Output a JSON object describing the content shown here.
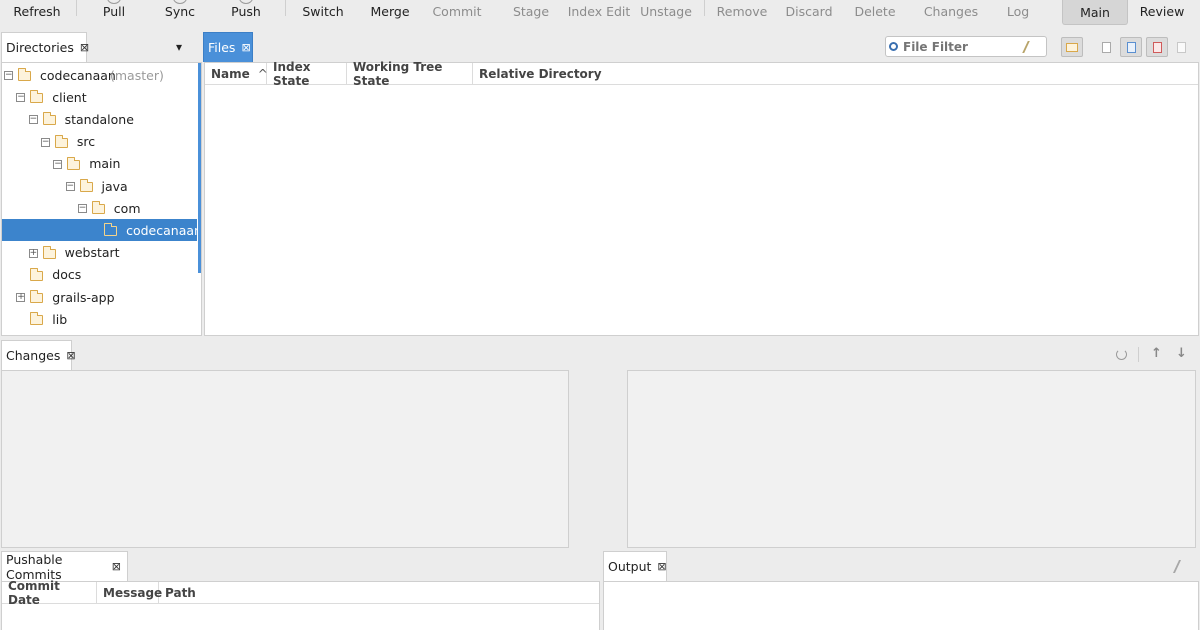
{
  "toolbar": {
    "refresh": "Refresh",
    "pull": "Pull",
    "sync": "Sync",
    "push": "Push",
    "switch": "Switch",
    "merge": "Merge",
    "commit": "Commit",
    "stage": "Stage",
    "index_edit": "Index Edit",
    "unstage": "Unstage",
    "remove": "Remove",
    "discard": "Discard",
    "delete": "Delete",
    "changes": "Changes",
    "log": "Log",
    "main": "Main",
    "review": "Review"
  },
  "directories": {
    "tab_label": "Directories",
    "close": "⊠",
    "dropdown": "▾",
    "tree": [
      {
        "label": "codecanaan",
        "suffix": "(master)",
        "toggle": "−"
      },
      {
        "label": "client",
        "toggle": "−"
      },
      {
        "label": "standalone",
        "toggle": "−"
      },
      {
        "label": "src",
        "toggle": "−"
      },
      {
        "label": "main",
        "toggle": "−"
      },
      {
        "label": "java",
        "toggle": "−"
      },
      {
        "label": "com",
        "toggle": "−"
      },
      {
        "label": "codecanaan",
        "toggle": ""
      },
      {
        "label": "webstart",
        "toggle": "+"
      },
      {
        "label": "docs",
        "toggle": ""
      },
      {
        "label": "grails-app",
        "toggle": "+"
      },
      {
        "label": "lib",
        "toggle": ""
      }
    ]
  },
  "files": {
    "tab_label": "Files",
    "close": "⊠",
    "filter_placeholder": "File Filter",
    "columns": [
      "Name",
      "Index State",
      "Working Tree State",
      "Relative Directory"
    ],
    "sort_indicator": "^"
  },
  "changes": {
    "tab_label": "Changes",
    "close": "⊠"
  },
  "pushable": {
    "tab_label": "Pushable Commits",
    "close": "⊠",
    "columns": [
      "Commit Date",
      "Message",
      "Path"
    ]
  },
  "output": {
    "tab_label": "Output",
    "close": "⊠"
  },
  "colors": {
    "accent": "#4a90d9",
    "selection": "#3c84cc",
    "folder": "#d9a84a",
    "disabled_text": "#8c8c8c"
  }
}
